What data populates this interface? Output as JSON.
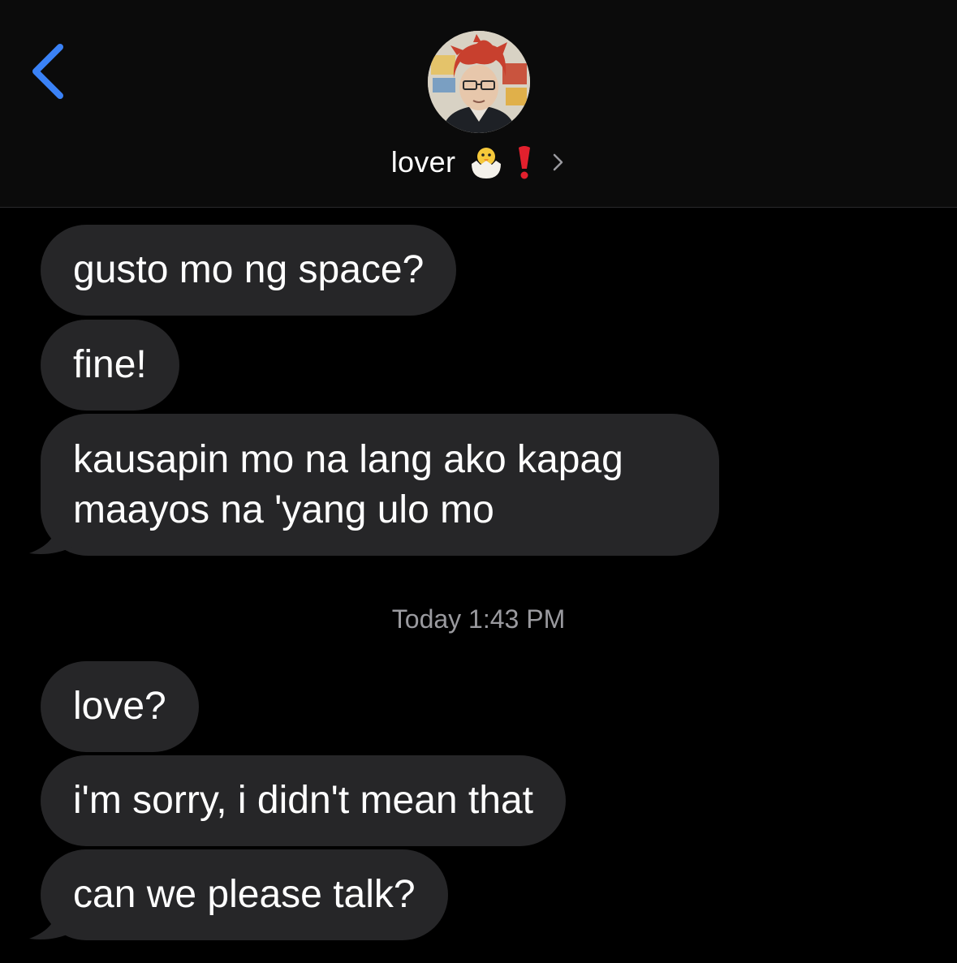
{
  "header": {
    "contact_name": "lover",
    "back_icon": "chevron-left-icon",
    "detail_icon": "chevron-right-icon",
    "accent_color": "#3a82f7"
  },
  "thread": {
    "messages_before": [
      "gusto mo ng space?",
      "fine!",
      "kausapin mo na lang ako kapag maayos na 'yang ulo mo"
    ],
    "timestamp": "Today 1:43 PM",
    "messages_after": [
      "love?",
      "i'm sorry, i didn't mean that",
      "can we please talk?"
    ],
    "bubble_color": "#262628"
  }
}
